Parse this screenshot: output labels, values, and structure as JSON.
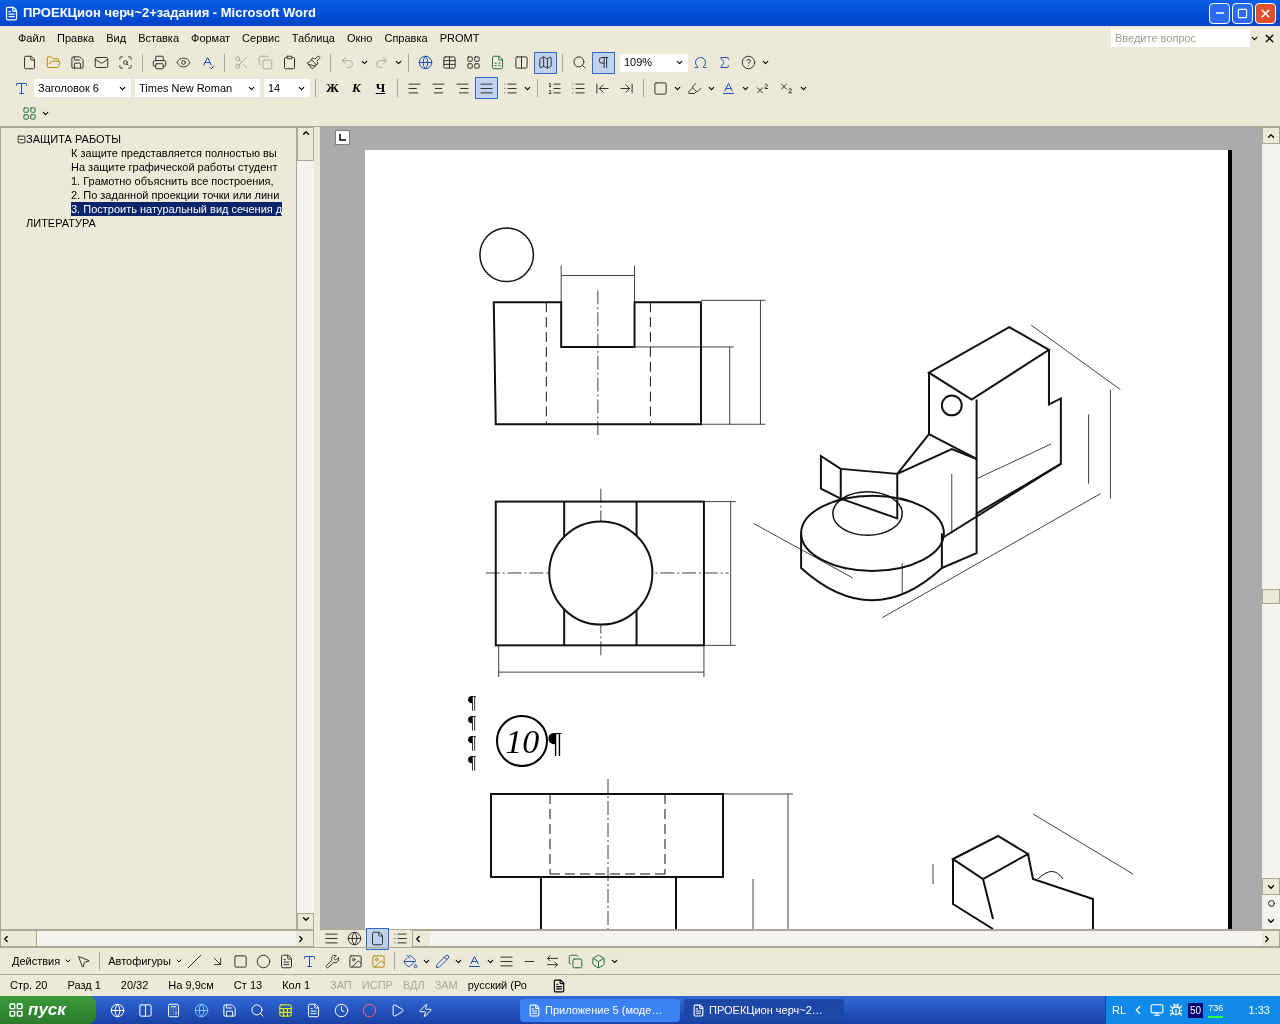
{
  "window": {
    "title": "ПРОЕКЦион черч~2+задания - Microsoft Word"
  },
  "menu": [
    "Файл",
    "Правка",
    "Вид",
    "Вставка",
    "Формат",
    "Сервис",
    "Таблица",
    "Окно",
    "Справка",
    "PROMT"
  ],
  "help_box": {
    "placeholder": "Введите вопрос"
  },
  "standard_toolbar": {
    "document_map_pressed": true,
    "formatting_marks_pressed": true,
    "zoom": "109%"
  },
  "formatting_toolbar": {
    "style": "Заголовок 6",
    "font": "Times New Roman",
    "size": "14",
    "text_buttons": [
      "Ж",
      "К",
      "Ч"
    ],
    "alignment": [
      {
        "selected": false
      },
      {
        "selected": false
      },
      {
        "selected": false
      },
      {
        "selected": true
      }
    ]
  },
  "document_map": [
    {
      "label": "ЗАЩИТА РАБОТЫ",
      "expanded": true,
      "children": [
        {
          "label": "К защите представляется полностью вы",
          "selected": false
        },
        {
          "label": "На защите графической работы студент",
          "selected": false
        },
        {
          "label": "1. Грамотно объяснить все построения,",
          "selected": false
        },
        {
          "label": "2. По заданной проекции точки или лини",
          "selected": false
        },
        {
          "label": "3. Построить натуральный вид сечения д",
          "selected": true
        }
      ]
    },
    {
      "label": "ЛИТЕРАТУРА",
      "expanded": false
    }
  ],
  "document": {
    "paragraph_marks": [
      "¶",
      "¶",
      "¶",
      "¶"
    ],
    "heading": {
      "number": "10",
      "mark": "¶"
    }
  },
  "drawing_toolbar": {
    "actions": "Действия",
    "autoshapes": "Автофигуры"
  },
  "status_bar": [
    {
      "text": "Стр. 20",
      "disabled": false
    },
    {
      "text": "Разд 1",
      "disabled": false
    },
    {
      "text": "20/32",
      "disabled": false
    },
    {
      "text": "На 9,9см",
      "disabled": false
    },
    {
      "text": "Ст 13",
      "disabled": false
    },
    {
      "text": "Кол 1",
      "disabled": false
    },
    {
      "text": "ЗАП",
      "disabled": true
    },
    {
      "text": "ИСПР",
      "disabled": true
    },
    {
      "text": "ВДЛ",
      "disabled": true
    },
    {
      "text": "ЗАМ",
      "disabled": true
    },
    {
      "text": "русский (Ро",
      "disabled": false
    }
  ],
  "taskbar": {
    "start": "пуск",
    "tasks": [
      {
        "label": "Приложение 5 (моде…",
        "selected": false
      },
      {
        "label": "ПРОЕКЦион черч~2…",
        "selected": true
      }
    ],
    "tray": {
      "language": "RL",
      "badge": "50",
      "meter": "736",
      "clock": "1:33"
    }
  }
}
